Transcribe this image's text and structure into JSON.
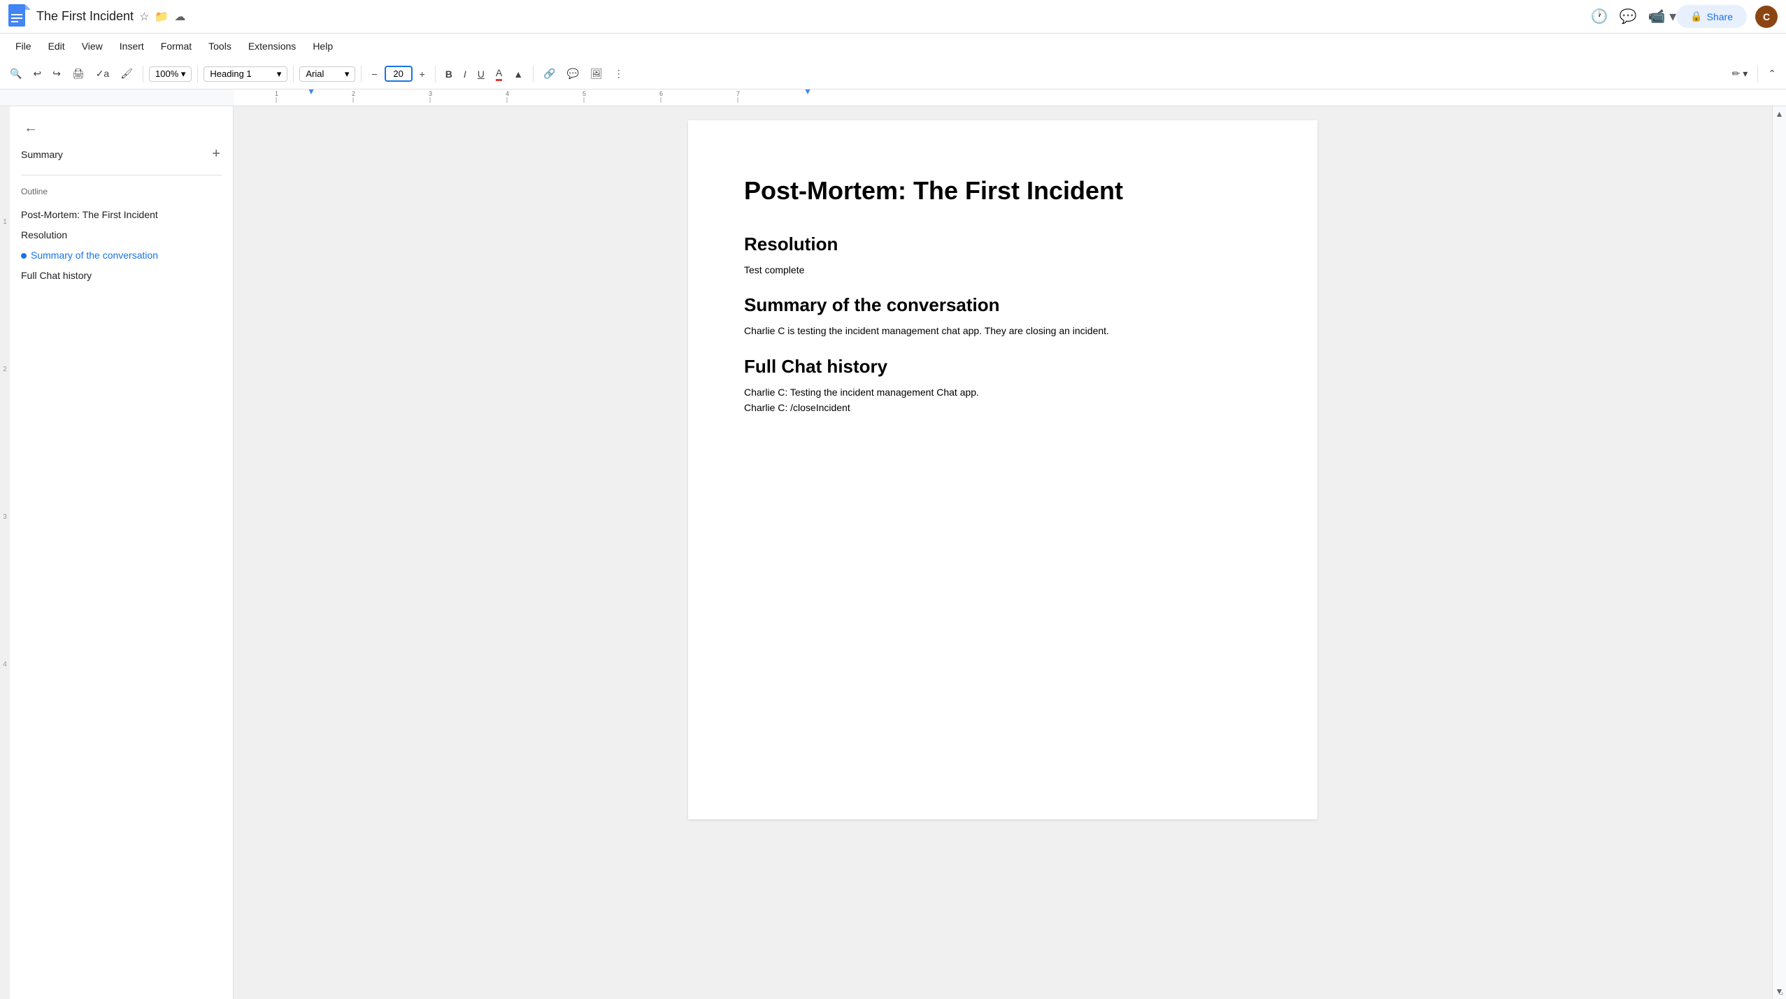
{
  "app": {
    "name": "Google Docs",
    "icon": "📄"
  },
  "document": {
    "title": "The First Incident",
    "title_display": "Post-Mortem: The First Incident"
  },
  "titlebar": {
    "back_label": "←",
    "star_icon": "☆",
    "folder_icon": "📁",
    "cloud_icon": "☁",
    "share_label": "Share",
    "lock_icon": "🔒",
    "history_icon": "🕐",
    "comment_icon": "💬",
    "video_icon": "📹"
  },
  "menubar": {
    "items": [
      "File",
      "Edit",
      "View",
      "Insert",
      "Format",
      "Tools",
      "Extensions",
      "Help"
    ]
  },
  "toolbar": {
    "search_icon": "🔍",
    "undo_icon": "↩",
    "redo_icon": "↪",
    "print_icon": "🖨",
    "spell_icon": "✓",
    "paint_icon": "🖌",
    "zoom": "100%",
    "zoom_label": "100%",
    "style": "Heading 1",
    "font": "Arial",
    "font_size": "20",
    "bold": "B",
    "italic": "I",
    "underline": "U",
    "text_color": "A",
    "highlight": "▲",
    "link": "🔗",
    "comment": "💬",
    "image": "🖼",
    "more": "⋮",
    "edit_mode": "✏",
    "expand": "⌃"
  },
  "sidebar": {
    "back_label": "←",
    "summary_label": "Summary",
    "add_label": "+",
    "outline_label": "Outline",
    "outline_items": [
      {
        "id": "item1",
        "label": "Post-Mortem: The First Incident",
        "active": false
      },
      {
        "id": "item2",
        "label": "Resolution",
        "active": false
      },
      {
        "id": "item3",
        "label": "Summary of the conversation",
        "active": true
      },
      {
        "id": "item4",
        "label": "Full Chat history",
        "active": false
      }
    ]
  },
  "content": {
    "title": "Post-Mortem: The First Incident",
    "sections": [
      {
        "heading": "Resolution",
        "body": "Test complete"
      },
      {
        "heading": "Summary of the conversation",
        "body": "Charlie C is testing the incident management chat app. They are closing an incident."
      },
      {
        "heading": "Full Chat history",
        "lines": [
          "Charlie C: Testing the incident management Chat app.",
          "Charlie C: /closeIncident"
        ]
      }
    ]
  }
}
